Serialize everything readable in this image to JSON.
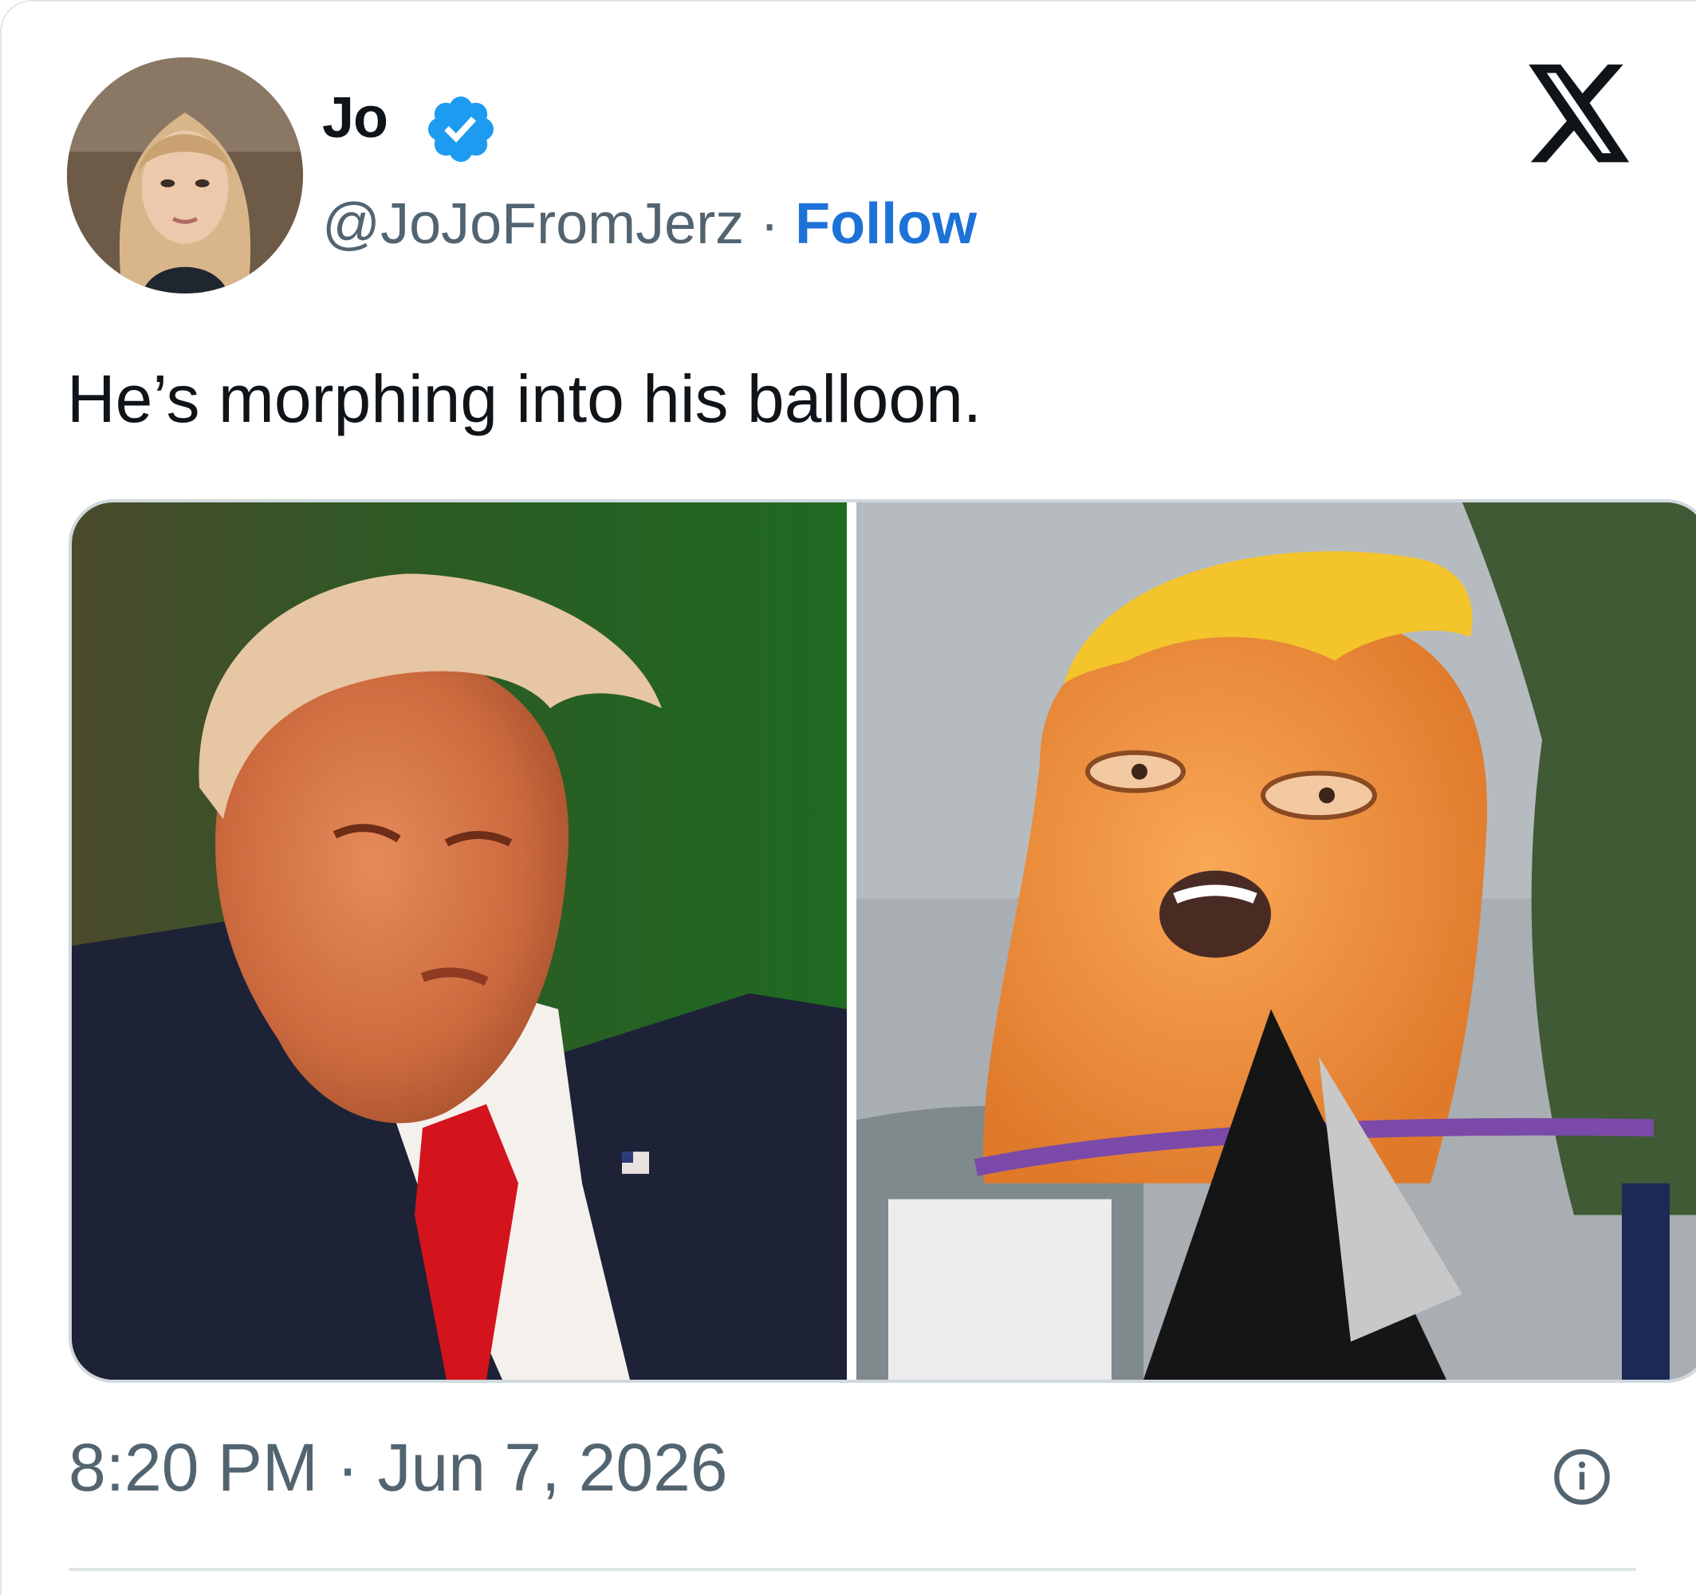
{
  "post": {
    "author_name": "Jo",
    "author_handle": "@JoJoFromJerz",
    "separator": " · ",
    "follow_label": "Follow",
    "text": "He’s morphing into his balloon.",
    "timestamp": "8:20 PM · Jun 7, 2026"
  },
  "icons": {
    "verified": "verified-badge-icon",
    "brand": "x-logo-icon",
    "info": "info-icon"
  },
  "colors": {
    "follow": "#1d72d8",
    "verified": "#1d9bf0",
    "muted_text": "#536471"
  }
}
